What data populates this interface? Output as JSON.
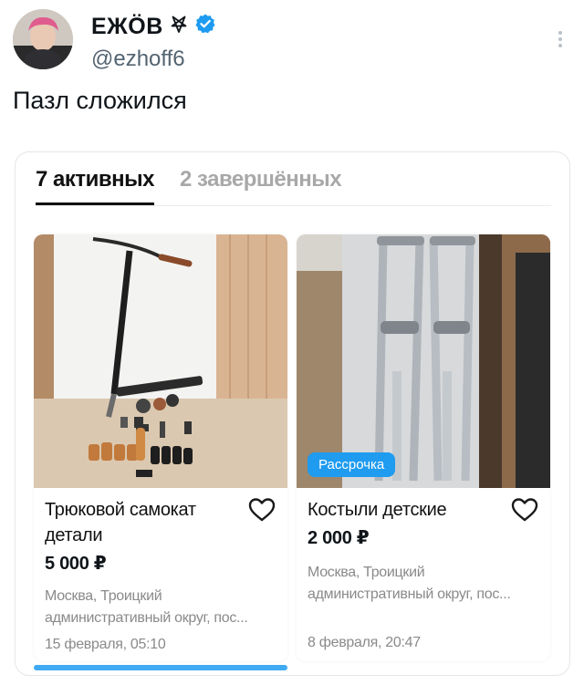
{
  "tweet": {
    "display_name": "ЕЖÖВ",
    "handle": "@ezhoff6",
    "text": "Пазл сложился",
    "pentagram_icon": "inverted-pentagram-icon",
    "verified_icon": "verified-badge-icon",
    "verified_color": "#1d9bf0"
  },
  "card": {
    "tabs": [
      {
        "label": "7 активных",
        "active": true
      },
      {
        "label": "2 завершённых",
        "active": false
      }
    ],
    "listings": [
      {
        "title": "Трюковой самокат детали",
        "price": "5 000 ₽",
        "address_line1": "Москва, Троицкий",
        "address_line2": "административный округ, пос...",
        "date": "15 февраля, 05:10",
        "badge": ""
      },
      {
        "title": "Костыли детские",
        "price": "2 000 ₽",
        "address_line1": "Москва, Троицкий",
        "address_line2": "административный округ, пос...",
        "date": "8 февраля, 20:47",
        "badge": "Рассрочка"
      }
    ]
  },
  "colors": {
    "accent": "#1f9bf0",
    "text_muted": "#8a8a8a"
  }
}
